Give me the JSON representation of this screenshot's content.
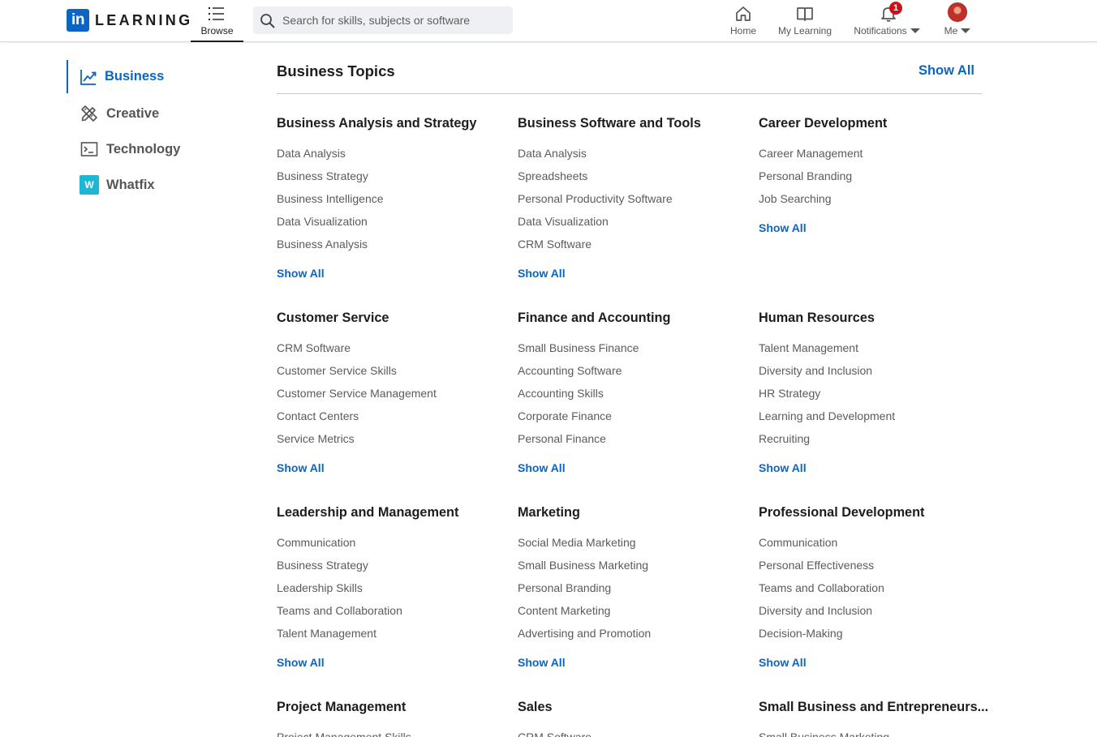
{
  "app": {
    "logo_in": "in",
    "logo_text": "LEARNING"
  },
  "header": {
    "browse_label": "Browse",
    "search_placeholder": "Search for skills, subjects or software",
    "nav": {
      "home": "Home",
      "my_learning": "My Learning",
      "notifications": "Notifications",
      "me": "Me"
    },
    "notification_count": "1"
  },
  "sidebar": {
    "items": [
      {
        "label": "Business",
        "icon": "chart-icon",
        "active": true
      },
      {
        "label": "Creative",
        "icon": "pencil-ruler-icon"
      },
      {
        "label": "Technology",
        "icon": "terminal-icon"
      },
      {
        "label": "Whatfix",
        "icon": "whatfix-logo",
        "icon_text": "W"
      }
    ]
  },
  "main": {
    "title": "Business Topics",
    "show_all": "Show All",
    "categories": [
      {
        "title": "Business Analysis and Strategy",
        "items": [
          "Data Analysis",
          "Business Strategy",
          "Business Intelligence",
          "Data Visualization",
          "Business Analysis"
        ],
        "show_all": "Show All"
      },
      {
        "title": "Business Software and Tools",
        "items": [
          "Data Analysis",
          "Spreadsheets",
          "Personal Productivity Software",
          "Data Visualization",
          "CRM Software"
        ],
        "show_all": "Show All"
      },
      {
        "title": "Career Development",
        "items": [
          "Career Management",
          "Personal Branding",
          "Job Searching"
        ],
        "show_all": "Show All"
      },
      {
        "title": "Customer Service",
        "items": [
          "CRM Software",
          "Customer Service Skills",
          "Customer Service Management",
          "Contact Centers",
          "Service Metrics"
        ],
        "show_all": "Show All"
      },
      {
        "title": "Finance and Accounting",
        "items": [
          "Small Business Finance",
          "Accounting Software",
          "Accounting Skills",
          "Corporate Finance",
          "Personal Finance"
        ],
        "show_all": "Show All"
      },
      {
        "title": "Human Resources",
        "items": [
          "Talent Management",
          "Diversity and Inclusion",
          "HR Strategy",
          "Learning and Development",
          "Recruiting"
        ],
        "show_all": "Show All"
      },
      {
        "title": "Leadership and Management",
        "items": [
          "Communication",
          "Business Strategy",
          "Leadership Skills",
          "Teams and Collaboration",
          "Talent Management"
        ],
        "show_all": "Show All"
      },
      {
        "title": "Marketing",
        "items": [
          "Social Media Marketing",
          "Small Business Marketing",
          "Personal Branding",
          "Content Marketing",
          "Advertising and Promotion"
        ],
        "show_all": "Show All"
      },
      {
        "title": "Professional Development",
        "items": [
          "Communication",
          "Personal Effectiveness",
          "Teams and Collaboration",
          "Diversity and Inclusion",
          "Decision-Making"
        ],
        "show_all": "Show All"
      },
      {
        "title": "Project Management",
        "items": [
          "Project Management Skills"
        ],
        "show_all": ""
      },
      {
        "title": "Sales",
        "items": [
          "CRM Software"
        ],
        "show_all": ""
      },
      {
        "title": "Small Business and Entrepreneurs...",
        "items": [
          "Small Business Marketing"
        ],
        "show_all": ""
      }
    ]
  },
  "colors": {
    "brand": "#0a66c2",
    "badge": "#cc1016",
    "whatfix": "#1fb6d4"
  }
}
